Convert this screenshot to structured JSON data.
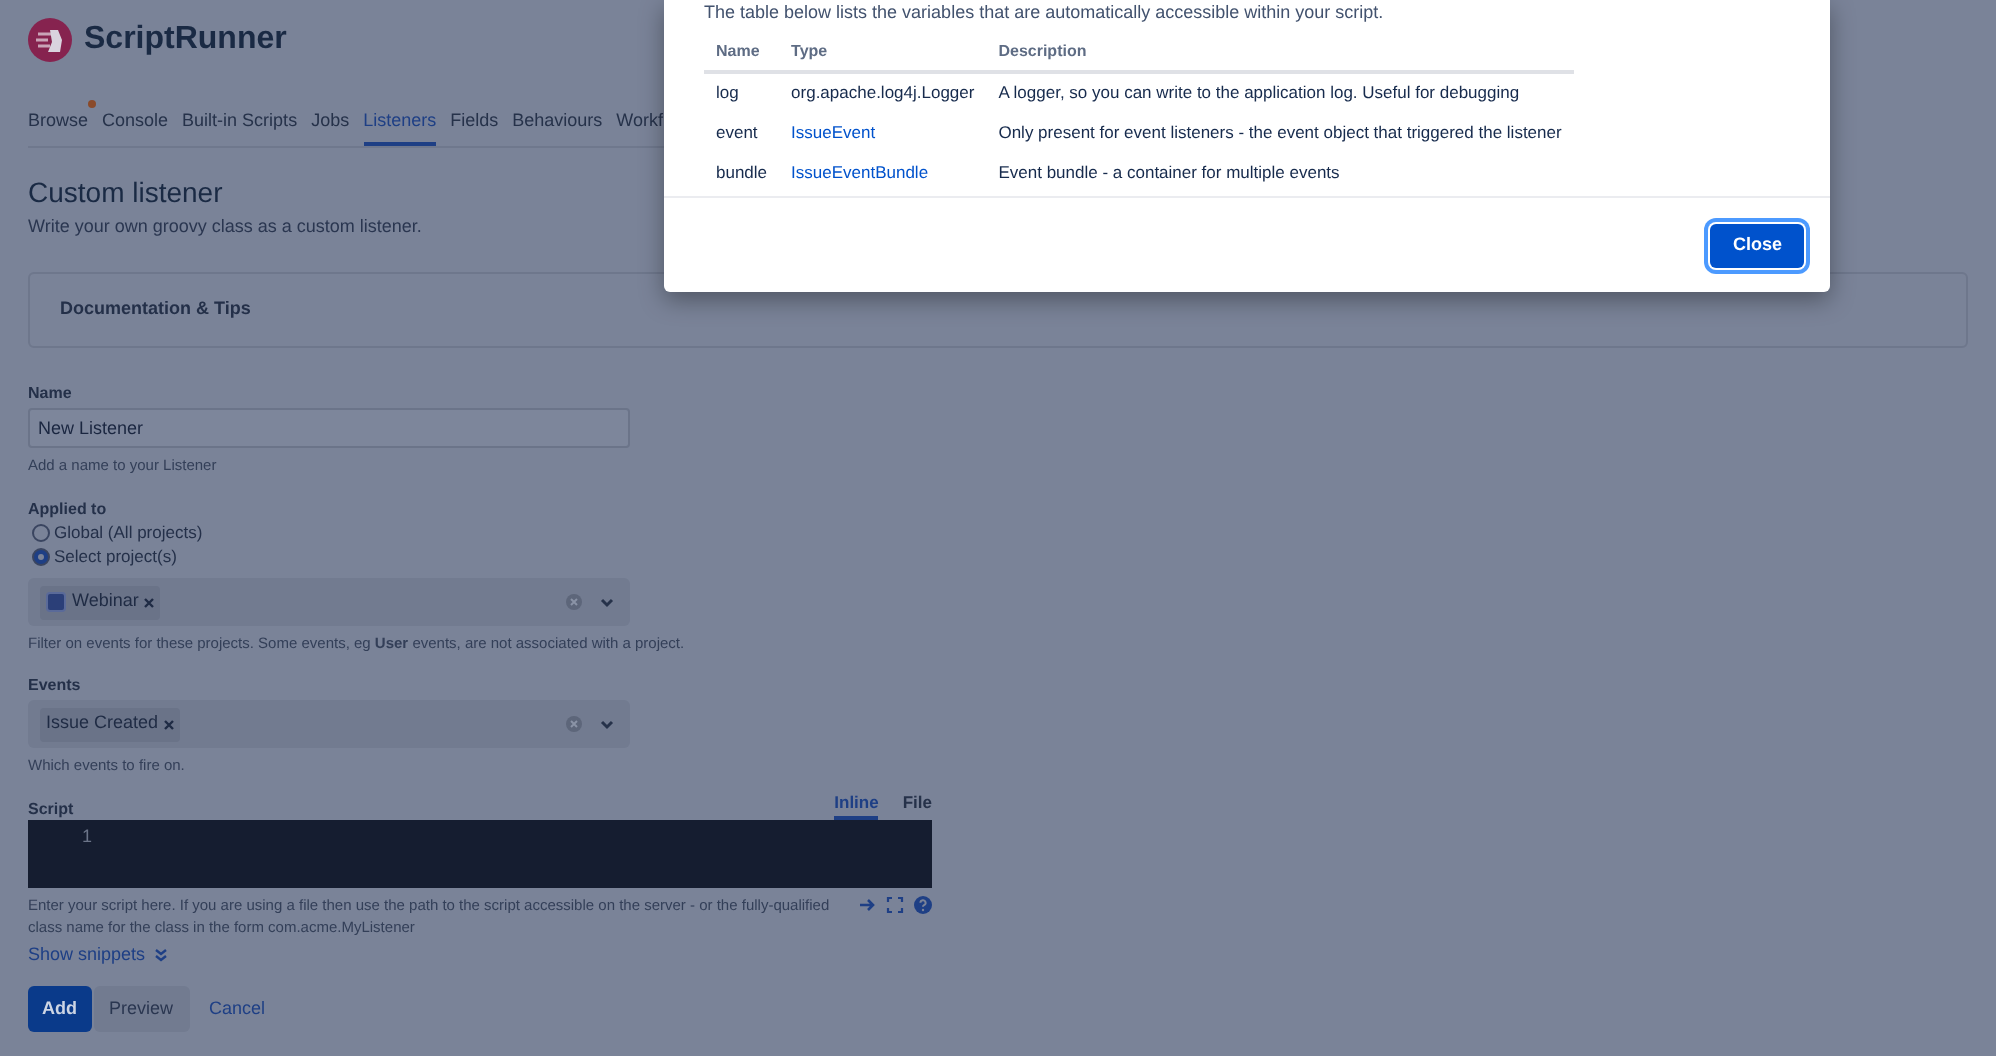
{
  "app": {
    "logo_text": "ScriptRunner"
  },
  "nav": [
    {
      "label": "Browse",
      "selected": false,
      "dot": true
    },
    {
      "label": "Console",
      "selected": false,
      "dot": false
    },
    {
      "label": "Built-in Scripts",
      "selected": false,
      "dot": false
    },
    {
      "label": "Jobs",
      "selected": false,
      "dot": false
    },
    {
      "label": "Listeners",
      "selected": true,
      "dot": false
    },
    {
      "label": "Fields",
      "selected": false,
      "dot": false
    },
    {
      "label": "Behaviours",
      "selected": false,
      "dot": false
    },
    {
      "label": "Workf",
      "selected": false,
      "dot": false
    }
  ],
  "page": {
    "title": "Custom listener",
    "subtitle": "Write your own groovy class as a custom listener."
  },
  "docs_panel": {
    "title": "Documentation & Tips"
  },
  "form": {
    "name": {
      "label": "Name",
      "value": "New Listener",
      "help": "Add a name to your Listener"
    },
    "applied_to": {
      "label": "Applied to",
      "options": [
        {
          "label": "Global (All projects)",
          "selected": false
        },
        {
          "label": "Select project(s)",
          "selected": true
        }
      ],
      "chips": [
        {
          "label": "Webinar"
        }
      ],
      "help": "Filter on events for these projects. Some events, eg **User** events, are not associated with a project."
    },
    "events": {
      "label": "Events",
      "chips": [
        {
          "label": "Issue Created"
        }
      ],
      "help": "Which events to fire on."
    },
    "script": {
      "label": "Script",
      "tabs": [
        {
          "label": "Inline",
          "selected": true
        },
        {
          "label": "File",
          "selected": false
        }
      ],
      "line_numbers": [
        "1"
      ],
      "help": "Enter your script here. If you are using a file then use the path to the script accessible on the server - or the fully-qualified class name for the class in the form com.acme.MyListener"
    },
    "show_snippets": "Show snippets",
    "buttons": [
      {
        "label": "Add",
        "kind": "primary"
      },
      {
        "label": "Preview",
        "kind": "default"
      },
      {
        "label": "Cancel",
        "kind": "link"
      }
    ]
  },
  "modal": {
    "intro": "The table below lists the variables that are automatically accessible within your script.",
    "columns": [
      "Name",
      "Type",
      "Description"
    ],
    "rows": [
      {
        "name": "log",
        "type": "org.apache.log4j.Logger",
        "type_is_link": false,
        "description": "A logger, so you can write to the application log. Useful for debugging"
      },
      {
        "name": "event",
        "type": "IssueEvent",
        "type_is_link": true,
        "description": "Only present for event listeners - the event object that triggered the listener"
      },
      {
        "name": "bundle",
        "type": "IssueEventBundle",
        "type_is_link": true,
        "description": "Event bundle - a container for multiple events"
      }
    ],
    "close_button": "Close"
  }
}
